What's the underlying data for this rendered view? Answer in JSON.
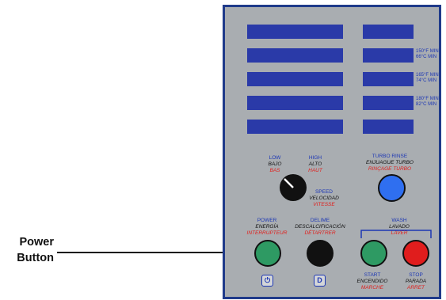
{
  "callout": {
    "line1": "Power",
    "line2": "Button"
  },
  "temps": [
    {
      "f": "150°F MIN",
      "c": "66°C MIN"
    },
    {
      "f": "165°F MIN",
      "c": "74°C MIN"
    },
    {
      "f": "180°F MIN",
      "c": "82°C MIN"
    }
  ],
  "speed": {
    "low": {
      "en": "LOW",
      "es": "BAJO",
      "fr": "BAS"
    },
    "high": {
      "en": "HIGH",
      "es": "ALTO",
      "fr": "HAUT"
    },
    "label": {
      "en": "SPEED",
      "es": "VELOCIDAD",
      "fr": "VITESSE"
    }
  },
  "turbo": {
    "en": "TURBO RINSE",
    "es": "ENJUAGUE TURBO",
    "fr": "RINÇAGE TURBO"
  },
  "power": {
    "en": "POWER",
    "es": "ENERGÍA",
    "fr": "INTERRUPTEUR",
    "icon": "⏻"
  },
  "delime": {
    "en": "DELIME",
    "es": "DESCALCIFICACIÓN",
    "fr": "DÉTARTRER",
    "icon": "D"
  },
  "wash": {
    "en": "WASH",
    "es": "LAVADO",
    "fr": "LAVER"
  },
  "start": {
    "en": "START",
    "es": "ENCENDIDO",
    "fr": "MARCHE"
  },
  "stop": {
    "en": "STOP",
    "es": "PARADA",
    "fr": "ARRET"
  },
  "colors": {
    "panel": "#a9adb1",
    "border": "#1f3a8a",
    "screen": "#2a3aa8",
    "power": "#2e9a63",
    "start": "#2e9a63",
    "stop": "#e01d1d",
    "turbo": "#2f6ff0",
    "english": "#1c36b4",
    "french": "#e0201d"
  }
}
